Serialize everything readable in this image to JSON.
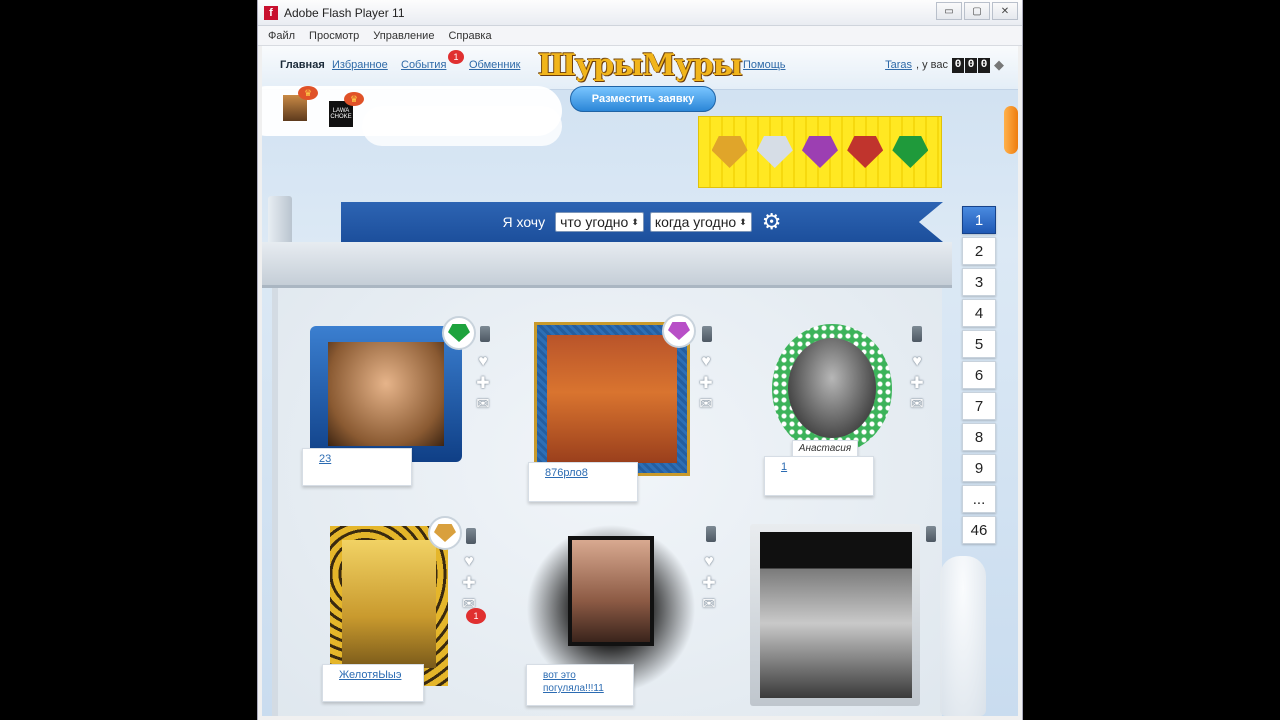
{
  "window": {
    "title": "Adobe Flash Player 11",
    "minimize": "▭",
    "maximize": "▢",
    "close": "✕"
  },
  "menu": [
    "Файл",
    "Просмотр",
    "Управление",
    "Справка"
  ],
  "nav": {
    "items": [
      {
        "label": "Главная",
        "active": true
      },
      {
        "label": "Избранное"
      },
      {
        "label": "События",
        "badge": "1"
      },
      {
        "label": "Обменник"
      },
      {
        "label": "Помощь"
      }
    ],
    "logo": "ШурыМуры",
    "user": "Taras",
    "user_suffix": ", у вас",
    "counter": [
      "0",
      "0",
      "0"
    ],
    "post_button": "Разместить заявку"
  },
  "mini_avatars": [
    {
      "crown": "♛"
    },
    {
      "text": "LAWA CHOKE",
      "crown": "♛"
    }
  ],
  "gems": [
    {
      "name": "yellow-diamond",
      "color": "#e0a52a"
    },
    {
      "name": "white-diamond",
      "color": "#d6dde6"
    },
    {
      "name": "purple-gem",
      "color": "#9c3fb2"
    },
    {
      "name": "red-gem",
      "color": "#c0342d"
    },
    {
      "name": "green-gem",
      "color": "#1f9a3b"
    }
  ],
  "filter": {
    "label": "Я хочу",
    "what": "что угодно",
    "when": "когда угодно",
    "arrow": "⬍",
    "gear": "⚙"
  },
  "pagination": [
    "1",
    "2",
    "3",
    "4",
    "5",
    "6",
    "7",
    "8",
    "9",
    "...",
    "46"
  ],
  "profiles": [
    {
      "name": "23",
      "badge_color": "#1ea33d"
    },
    {
      "name": "876рло8",
      "badge_color": "#b84fc7"
    },
    {
      "name": "1",
      "caption": "Анастасия"
    },
    {
      "name": "ЖелотяЫыэ",
      "badge_color": "#d9a03d",
      "msg_badge": "1"
    },
    {
      "name": "вот это погуляла!!!11"
    },
    {
      "name": ""
    }
  ],
  "icons": {
    "heart": "♥",
    "plus": "✚",
    "mail": "✉"
  }
}
